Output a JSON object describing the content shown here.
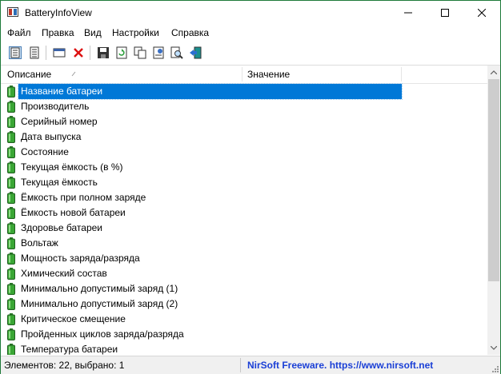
{
  "window": {
    "title": "BatteryInfoView"
  },
  "menu": {
    "items": [
      {
        "label": "Файл"
      },
      {
        "label": "Правка"
      },
      {
        "label": "Вид"
      },
      {
        "label": "Настройки"
      },
      {
        "label": "Справка"
      }
    ]
  },
  "toolbar": {
    "buttons": [
      {
        "icon": "battery-info-mode-icon"
      },
      {
        "icon": "battery-log-mode-icon"
      },
      {
        "icon": "properties-window-icon"
      },
      {
        "icon": "delete-icon"
      },
      {
        "icon": "save-icon"
      },
      {
        "icon": "refresh-icon"
      },
      {
        "icon": "copy-icon"
      },
      {
        "icon": "html-report-icon"
      },
      {
        "icon": "find-icon"
      },
      {
        "icon": "exit-icon"
      }
    ]
  },
  "list": {
    "columns": [
      {
        "label": "Описание",
        "sorted": "ascending"
      },
      {
        "label": "Значение"
      }
    ],
    "selected_index": 0,
    "rows": [
      "Название батареи",
      "Производитель",
      "Серийный номер",
      "Дата выпуска",
      "Состояние",
      "Текущая ёмкость (в %)",
      "Текущая ёмкость",
      "Ёмкость при полном заряде",
      "Ёмкость новой батареи",
      "Здоровье батареи",
      "Вольтаж",
      "Мощность заряда/разряда",
      "Химический состав",
      "Минимально допустимый заряд (1)",
      "Минимально допустимый заряд (2)",
      "Критическое смещение",
      "Пройденных циклов заряда/разряда",
      "Температура батареи"
    ]
  },
  "status": {
    "left": "Элементов: 22, выбрано: 1",
    "right": "NirSoft Freeware. https://www.nirsoft.net"
  },
  "colors": {
    "selection": "#0078d7",
    "battery_green": "#3aa635",
    "link_blue": "#1a3fd6"
  }
}
